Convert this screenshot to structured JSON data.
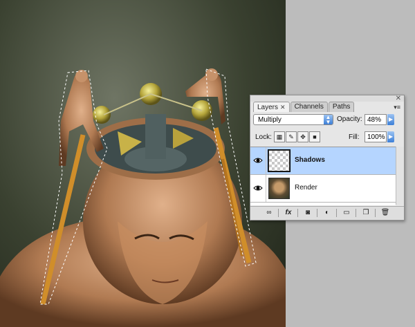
{
  "panel": {
    "tabs": [
      {
        "label": "Layers",
        "close": "✕"
      },
      {
        "label": "Channels"
      },
      {
        "label": "Paths"
      }
    ],
    "blend_mode": "Multiply",
    "opacity_label": "Opacity:",
    "opacity_value": "48%",
    "lock_label": "Lock:",
    "fill_label": "Fill:",
    "fill_value": "100%",
    "layers": [
      {
        "name": "Shadows",
        "selected": true
      },
      {
        "name": "Render",
        "selected": false
      }
    ]
  },
  "icons": {
    "panel_close": "close-icon",
    "panel_menu": "panel-menu-icon",
    "eye": "eye-icon",
    "link": "link-layers-icon",
    "fx": "fx-icon",
    "mask": "layer-mask-icon",
    "adjust": "adjustment-layer-icon",
    "group": "new-group-icon",
    "new_layer": "new-layer-icon",
    "trash": "trash-icon"
  },
  "colors": {
    "selection": "#b5d5ff",
    "accent": "#3c7fd7",
    "background_gray": "#bcbcbc"
  }
}
